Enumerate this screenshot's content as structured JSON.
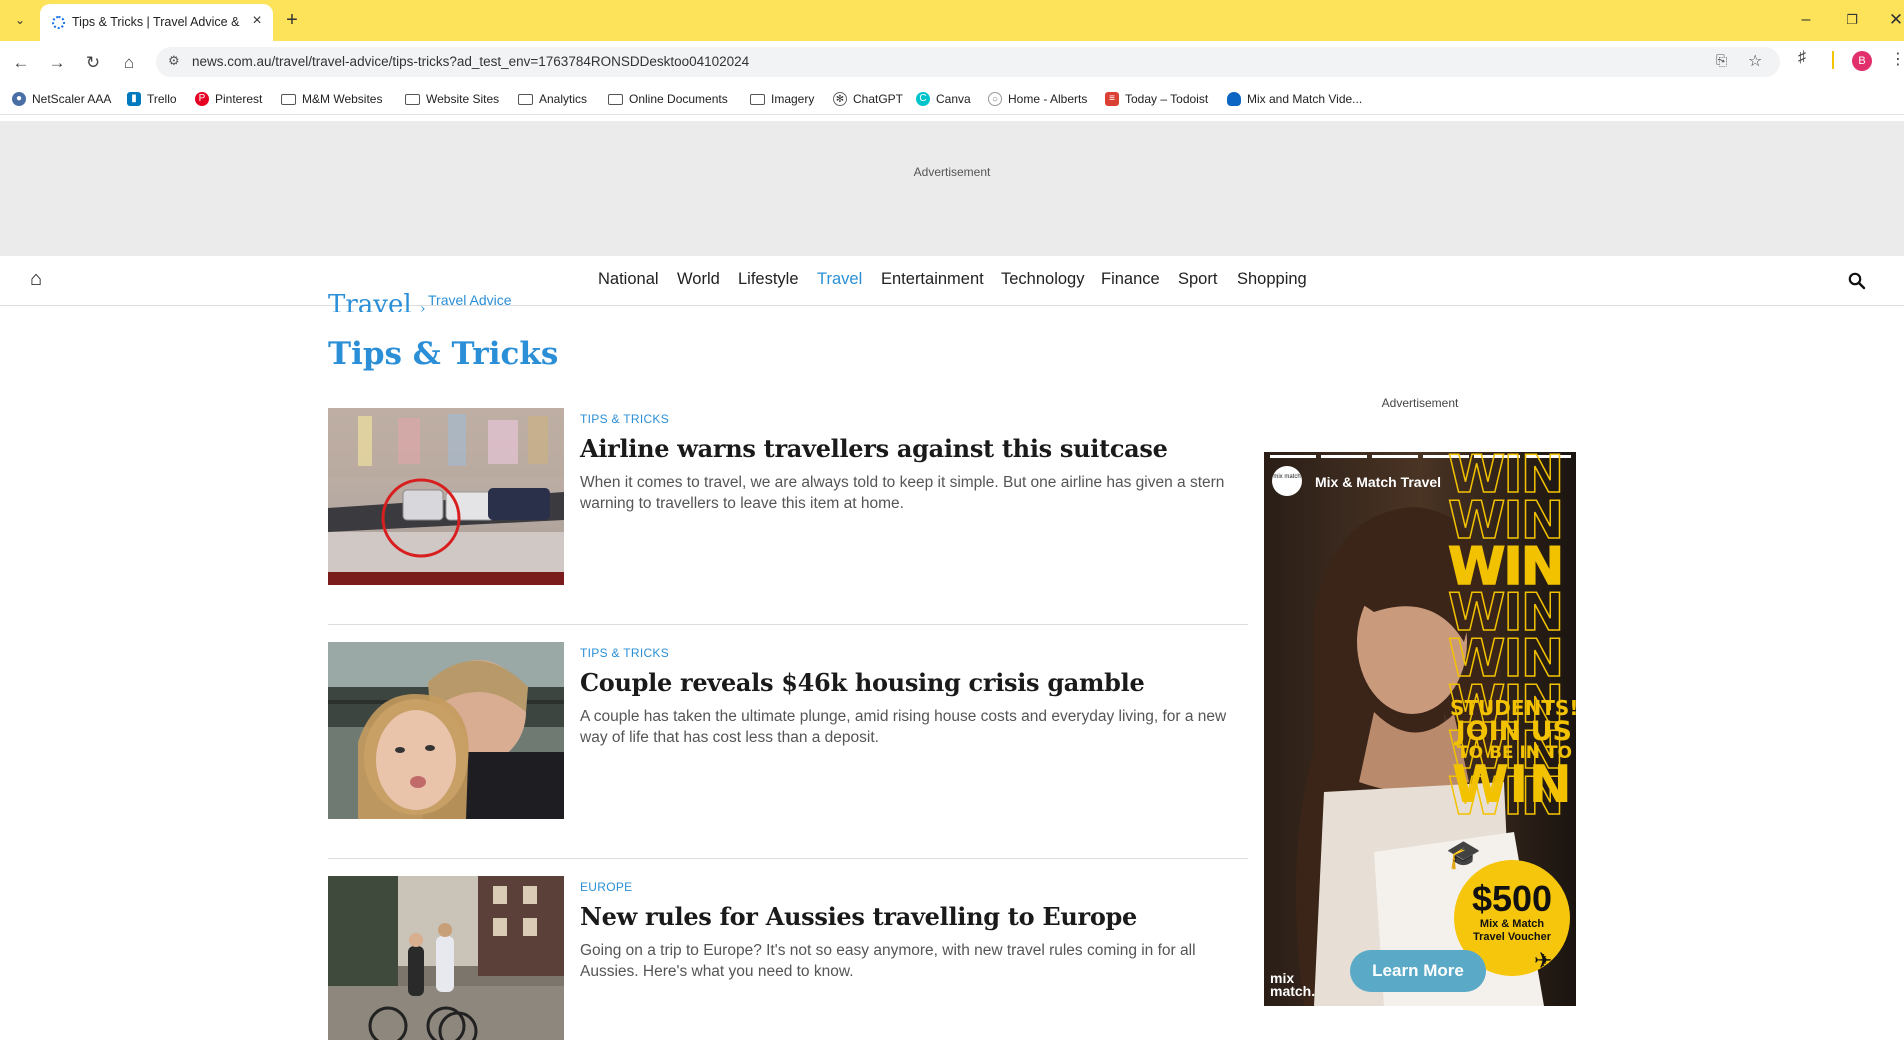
{
  "browser": {
    "tab_title": "Tips & Tricks | Travel Advice & Ne",
    "url": "news.com.au/travel/travel-advice/tips-tricks?ad_test_env=1763784RONSDDesktoo04102024",
    "profile_initial": "B"
  },
  "bookmarks": [
    {
      "label": "NetScaler AAA",
      "icon": "netscaler-icon"
    },
    {
      "label": "Trello",
      "icon": "trello-icon"
    },
    {
      "label": "Pinterest",
      "icon": "pinterest-icon"
    },
    {
      "label": "M&M Websites",
      "icon": "folder-icon"
    },
    {
      "label": "Website Sites",
      "icon": "folder-icon"
    },
    {
      "label": "Analytics",
      "icon": "folder-icon"
    },
    {
      "label": "Online Documents",
      "icon": "folder-icon"
    },
    {
      "label": "Imagery",
      "icon": "folder-icon"
    },
    {
      "label": "ChatGPT",
      "icon": "chatgpt-icon"
    },
    {
      "label": "Canva",
      "icon": "canva-icon"
    },
    {
      "label": "Home - Alberts",
      "icon": "globe-icon"
    },
    {
      "label": "Today – Todoist",
      "icon": "todoist-icon"
    },
    {
      "label": "Mix and Match Vide...",
      "icon": "cloud-icon"
    }
  ],
  "ads": {
    "top_label": "Advertisement",
    "side_label": "Advertisement",
    "side": {
      "brand_name": "Mix & Match Travel",
      "brand_avatar": "mix match",
      "headline_word": "WIN",
      "promo_line1": "STUDENTS!",
      "promo_line2": "JOIN US",
      "promo_line3": "TO BE IN TO",
      "promo_line4": "WIN",
      "prize_amount": "$500",
      "prize_line1": "Mix & Match",
      "prize_line2": "Travel Voucher",
      "cta": "Learn More",
      "logo_line1": "mix",
      "logo_line2": "match."
    }
  },
  "site_nav": {
    "items": [
      "National",
      "World",
      "Lifestyle",
      "Travel",
      "Entertainment",
      "Technology",
      "Finance",
      "Sport",
      "Shopping"
    ],
    "active": "Travel"
  },
  "breadcrumb": {
    "section": "Travel",
    "separator": "›",
    "subsection": "Travel Advice"
  },
  "page_title": "Tips & Tricks",
  "articles": [
    {
      "category": "TIPS & TRICKS",
      "headline": "Airline warns travellers against this suitcase",
      "summary": "When it comes to travel, we are always told to keep it simple. But one airline has given a stern warning to travellers to leave this item at home."
    },
    {
      "category": "TIPS & TRICKS",
      "headline": "Couple reveals $46k housing crisis gamble",
      "summary": "A couple has taken the ultimate plunge, amid rising house costs and everyday living, for a new way of life that has cost less than a deposit."
    },
    {
      "category": "EUROPE",
      "headline": "New rules for Aussies travelling to Europe",
      "summary": "Going on a trip to Europe? It's not so easy anymore, with new travel rules coming in for all Aussies. Here's what you need to know."
    }
  ]
}
